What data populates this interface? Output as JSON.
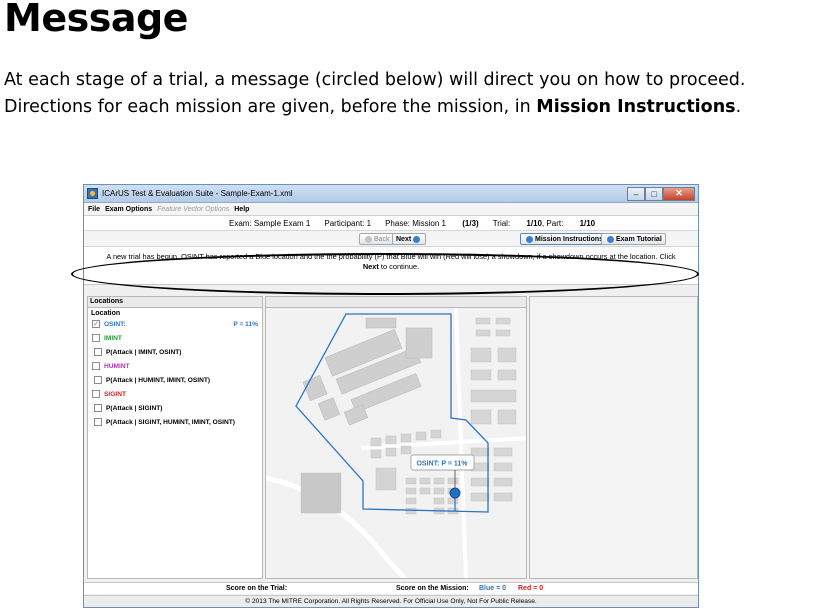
{
  "slide": {
    "title": "Message",
    "body_line1": "At each stage of a trial, a message (circled below) will direct you on how to proceed.",
    "body_line2_pre": "Directions for each mission are given, before the mission, in ",
    "body_line2_bold": "Mission Instructions",
    "body_line2_post": "."
  },
  "window": {
    "title": "ICArUS Test & Evaluation Suite - Sample-Exam-1.xml",
    "controls": {
      "minimize": "–",
      "maximize": "□",
      "close": "✕"
    }
  },
  "menu": {
    "file": "File",
    "exam_options": "Exam Options",
    "feature_vector_options": "Feature Vector Options",
    "help": "Help"
  },
  "info": {
    "exam": "Exam: Sample Exam 1",
    "participant": "Participant: 1",
    "phase_label": "Phase: Mission 1",
    "phase_value": "(1/3)",
    "trial_label": "Trial:",
    "trial_value": "1/10",
    "part_label": ", Part:",
    "part_value": "1/10"
  },
  "nav": {
    "back": "Back",
    "next": "Next",
    "mission_instructions": "Mission Instructions",
    "exam_tutorial": "Exam Tutorial"
  },
  "message": {
    "text": "A new trial has begun. OSINT has reported a Blue location and the the probability (P) that Blue will win (Red will lose) a showdown, if a showdown occurs at the location. Click",
    "next_word": "Next",
    "tail": " to continue."
  },
  "locations": {
    "header": "Locations",
    "label": "Location",
    "items": [
      {
        "label": "OSINT:",
        "color": "#2f74c0",
        "checked": true,
        "value": "P = 11%"
      },
      {
        "label": "IMINT",
        "color": "#1f9a3c",
        "checked": false
      },
      {
        "label": "P(Attack | IMINT, OSINT)",
        "color": "#000000",
        "checked": false
      },
      {
        "label": "HUMINT",
        "color": "#b02fb8",
        "checked": false
      },
      {
        "label": "P(Attack | HUMINT, IMINT, OSINT)",
        "color": "#000000",
        "checked": false
      },
      {
        "label": "SIGINT",
        "color": "#d21f1f",
        "checked": false
      },
      {
        "label": "P(Attack | SIGINT)",
        "color": "#000000",
        "checked": false
      },
      {
        "label": "P(Attack | SIGINT, HUMINT, IMINT, OSINT)",
        "color": "#000000",
        "checked": false
      }
    ]
  },
  "map": {
    "callout": "OSINT: P = 11%",
    "region_color": "#2a73c6",
    "marker_color": "#1f6fc7"
  },
  "score": {
    "trial_label": "Score on the Trial:",
    "mission_label": "Score on the Mission:",
    "blue": "Blue = 0",
    "red": "Red = 0",
    "blue_color": "#2f74c0",
    "red_color": "#d21f1f"
  },
  "footer": "© 2013 The MITRE Corporation. All Rights Reserved. For Official Use Only, Not For Public Release."
}
